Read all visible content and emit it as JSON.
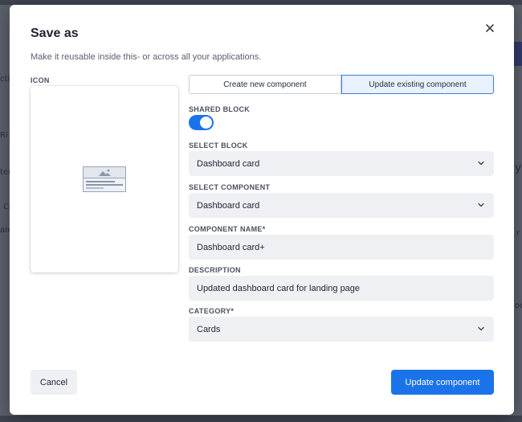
{
  "dialog": {
    "title": "Save as",
    "subtitle": "Make it reusable inside this- or across all your applications.",
    "close_icon": "close-icon"
  },
  "icon_section": {
    "label": "ICON",
    "placeholder_icon": "image-placeholder-icon"
  },
  "tabs": [
    {
      "label": "Create new component",
      "active": false
    },
    {
      "label": "Update existing component",
      "active": true
    }
  ],
  "shared_block": {
    "label": "SHARED BLOCK",
    "enabled": true
  },
  "select_block": {
    "label": "SELECT BLOCK",
    "value": "Dashboard card"
  },
  "select_component": {
    "label": "SELECT COMPONENT",
    "value": "Dashboard card"
  },
  "component_name": {
    "label": "COMPONENT NAME*",
    "value": "Dashboard card+"
  },
  "description": {
    "label": "DESCRIPTION",
    "value": "Updated dashboard card for landing page"
  },
  "category": {
    "label": "CATEGORY*",
    "value": "Cards"
  },
  "footer": {
    "cancel_label": "Cancel",
    "primary_label": "Update component"
  },
  "colors": {
    "primary": "#1a73e8",
    "field_bg": "#eef0f4",
    "active_tab_bg": "#e8f1fd"
  },
  "background_fragments": [
    "ctio",
    "Ri",
    "ter",
    "Ca",
    "aire",
    "y",
    "r",
    "oo"
  ]
}
